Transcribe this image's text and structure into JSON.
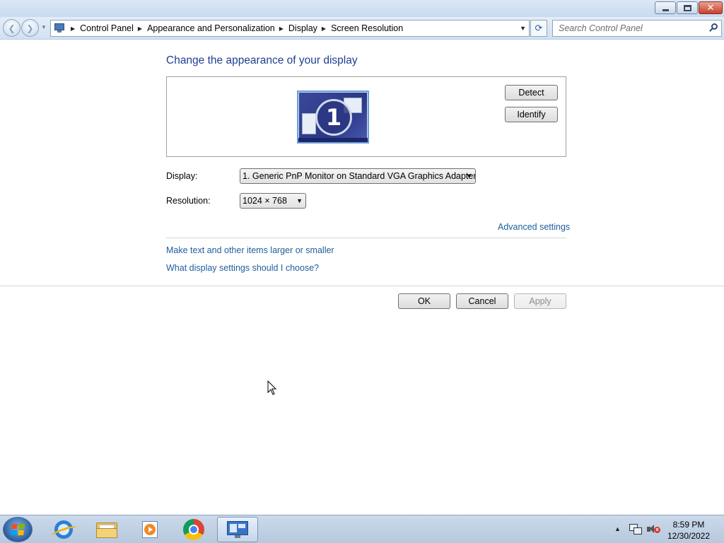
{
  "window": {
    "minimize_icon": "minimize-icon",
    "maximize_icon": "restore-icon",
    "close_icon": "close-icon",
    "close_glyph": "✕"
  },
  "navigation": {
    "back_glyph": "❮",
    "forward_glyph": "❯",
    "breadcrumbs": [
      "Control Panel",
      "Appearance and Personalization",
      "Display",
      "Screen Resolution"
    ],
    "refresh_glyph": "⟳",
    "search_placeholder": "Search Control Panel"
  },
  "page": {
    "heading": "Change the appearance of your display",
    "monitor_number": "1",
    "detect_label": "Detect",
    "identify_label": "Identify",
    "display_label": "Display:",
    "display_value": "1. Generic PnP Monitor on Standard VGA Graphics Adapter",
    "resolution_label": "Resolution:",
    "resolution_value": "1024 × 768",
    "advanced_link": "Advanced settings",
    "text_size_link": "Make text and other items larger or smaller",
    "choose_link": "What display settings should I choose?",
    "ok_label": "OK",
    "cancel_label": "Cancel",
    "apply_label": "Apply",
    "apply_enabled": false
  },
  "taskbar": {
    "apps": [
      "internet-explorer",
      "windows-explorer",
      "media-player",
      "google-chrome",
      "control-panel"
    ],
    "active_app": "control-panel",
    "time": "8:59 PM",
    "date": "12/30/2022"
  },
  "colors": {
    "link": "#1e5d9c",
    "heading": "#1e3f8f",
    "start_flag": [
      "#f25022",
      "#7fba00",
      "#00a4ef",
      "#ffb900"
    ]
  }
}
